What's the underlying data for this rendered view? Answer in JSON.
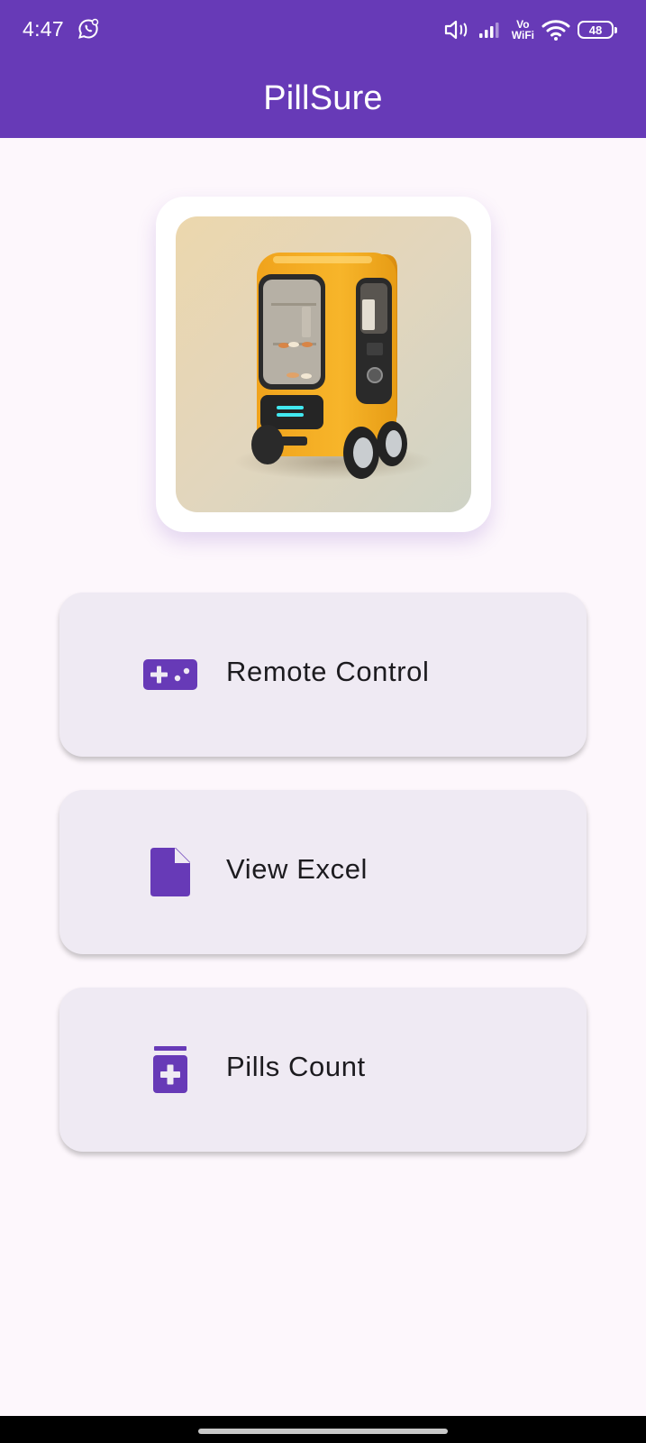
{
  "status_bar": {
    "time": "4:47",
    "network_label_top": "Vo",
    "network_label_bottom": "WiFi",
    "battery": "48"
  },
  "app_bar": {
    "title": "PillSure"
  },
  "buttons": [
    {
      "label": "Remote Control",
      "icon": "gamepad-icon"
    },
    {
      "label": "View Excel",
      "icon": "document-icon"
    },
    {
      "label": "Pills Count",
      "icon": "medication-icon"
    }
  ],
  "colors": {
    "primary": "#673ab7",
    "background": "#fdf7fc",
    "button_bg": "#efeaf3",
    "text": "#1c1b1f"
  }
}
